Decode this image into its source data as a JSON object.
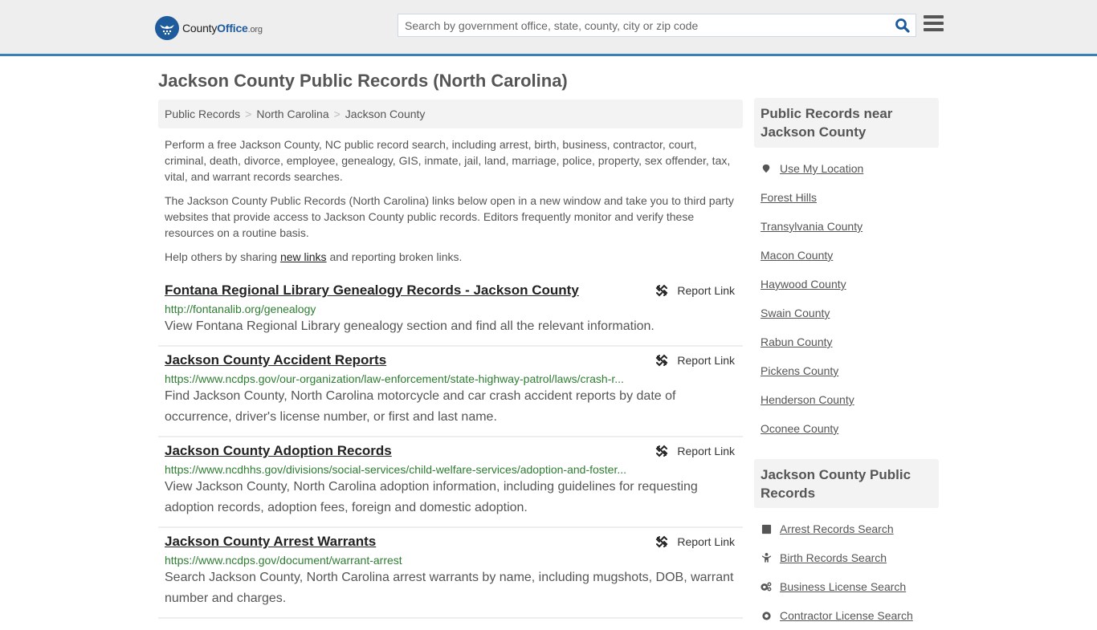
{
  "header": {
    "logo": {
      "county": "County",
      "office": "Office",
      "tld": ".org"
    },
    "search_placeholder": "Search by government office, state, county, city or zip code",
    "search_value": ""
  },
  "page_title": "Jackson County Public Records (North Carolina)",
  "breadcrumb": [
    {
      "label": "Public Records"
    },
    {
      "label": "North Carolina"
    },
    {
      "label": "Jackson County"
    }
  ],
  "breadcrumb_separator": ">",
  "intro": {
    "p1": "Perform a free Jackson County, NC public record search, including arrest, birth, business, contractor, court, criminal, death, divorce, employee, genealogy, GIS, inmate, jail, land, marriage, police, property, sex offender, tax, vital, and warrant records searches.",
    "p2": "The Jackson County Public Records (North Carolina) links below open in a new window and take you to third party websites that provide access to Jackson County public records. Editors frequently monitor and verify these resources on a routine basis.",
    "p3_before": "Help others by sharing ",
    "p3_link": "new links",
    "p3_after": " and reporting broken links."
  },
  "report_label": "Report Link",
  "records": [
    {
      "title": "Fontana Regional Library Genealogy Records - Jackson County",
      "url": "http://fontanalib.org/genealogy",
      "desc": "View Fontana Regional Library genealogy section and find all the relevant information."
    },
    {
      "title": "Jackson County Accident Reports",
      "url": "https://www.ncdps.gov/our-organization/law-enforcement/state-highway-patrol/laws/crash-r...",
      "desc": "Find Jackson County, North Carolina motorcycle and car crash accident reports by date of occurrence, driver's license number, or first and last name."
    },
    {
      "title": "Jackson County Adoption Records",
      "url": "https://www.ncdhhs.gov/divisions/social-services/child-welfare-services/adoption-and-foster...",
      "desc": "View Jackson County, North Carolina adoption information, including guidelines for requesting adoption records, adoption fees, foreign and domestic adoption."
    },
    {
      "title": "Jackson County Arrest Warrants",
      "url": "https://www.ncdps.gov/document/warrant-arrest",
      "desc": "Search Jackson County, North Carolina arrest warrants by name, including mugshots, DOB, warrant number and charges."
    }
  ],
  "sidebar": {
    "nearby_title": "Public Records near Jackson County",
    "use_location": "Use My Location",
    "nearby": [
      "Forest Hills",
      "Transylvania County",
      "Macon County",
      "Haywood County",
      "Swain County",
      "Rabun County",
      "Pickens County",
      "Henderson County",
      "Oconee County"
    ],
    "county_title": "Jackson County Public Records",
    "county_links": [
      {
        "label": "Arrest Records Search",
        "icon": "square-icon"
      },
      {
        "label": "Birth Records Search",
        "icon": "child-icon"
      },
      {
        "label": "Business License Search",
        "icon": "cogs-icon"
      },
      {
        "label": "Contractor License Search",
        "icon": "gear-icon"
      }
    ]
  },
  "colors": {
    "accent": "#3a7fb5",
    "brand": "#1e5b9c",
    "url_green": "#2e7d32",
    "text": "#555555"
  }
}
